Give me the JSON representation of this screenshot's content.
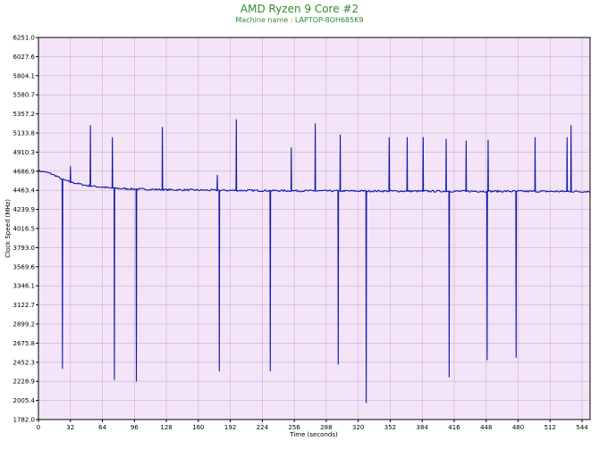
{
  "colors": {
    "title": "#2e8b2e",
    "plot_background": "#f3e4f7",
    "grid": "#c7aed2",
    "series": "#0d16a6",
    "axis": "#000000"
  },
  "chart_data": {
    "type": "line",
    "title": "AMD Ryzen 9 Core #2",
    "subtitle": "Machine name : LAPTOP-8OH685K9",
    "xlabel": "Time (seconds)",
    "ylabel": "Clock Speed (MHz)",
    "xlim": [
      0,
      552
    ],
    "ylim": [
      1782.0,
      6251.0
    ],
    "grid": true,
    "x_ticks": [
      0,
      32,
      64,
      96,
      128,
      160,
      192,
      224,
      256,
      288,
      320,
      352,
      384,
      416,
      448,
      480,
      512,
      544
    ],
    "y_ticks": [
      1782.0,
      2005.4,
      2228.9,
      2452.3,
      2675.8,
      2899.2,
      3122.7,
      3346.1,
      3569.6,
      3793.0,
      4016.5,
      4239.9,
      4463.4,
      4686.9,
      4910.3,
      5133.8,
      5357.2,
      5580.7,
      5804.1,
      6027.6,
      6251.0
    ],
    "series": [
      {
        "baseline": [
          [
            0,
            4690
          ],
          [
            6,
            4680
          ],
          [
            12,
            4660
          ],
          [
            18,
            4630
          ],
          [
            24,
            4590
          ],
          [
            32,
            4560
          ],
          [
            40,
            4540
          ],
          [
            48,
            4520
          ],
          [
            56,
            4510
          ],
          [
            64,
            4500
          ],
          [
            72,
            4490
          ],
          [
            80,
            4485
          ],
          [
            96,
            4478
          ],
          [
            112,
            4474
          ],
          [
            128,
            4470
          ],
          [
            160,
            4466
          ],
          [
            192,
            4462
          ],
          [
            224,
            4460
          ],
          [
            256,
            4458
          ],
          [
            288,
            4456
          ],
          [
            320,
            4455
          ],
          [
            352,
            4454
          ],
          [
            384,
            4453
          ],
          [
            416,
            4452
          ],
          [
            448,
            4452
          ],
          [
            480,
            4451
          ],
          [
            512,
            4450
          ],
          [
            552,
            4449
          ]
        ],
        "spikes": [
          [
            24,
            2380
          ],
          [
            32,
            4740
          ],
          [
            52,
            5220
          ],
          [
            74,
            5080
          ],
          [
            76,
            2250
          ],
          [
            98,
            2230
          ],
          [
            124,
            5200
          ],
          [
            179,
            4640
          ],
          [
            181,
            2350
          ],
          [
            198,
            5290
          ],
          [
            232,
            2350
          ],
          [
            253,
            4960
          ],
          [
            277,
            5240
          ],
          [
            300,
            2430
          ],
          [
            302,
            5110
          ],
          [
            328,
            1980
          ],
          [
            351,
            5080
          ],
          [
            369,
            5080
          ],
          [
            385,
            5080
          ],
          [
            408,
            5060
          ],
          [
            411,
            2280
          ],
          [
            428,
            5040
          ],
          [
            449,
            2480
          ],
          [
            450,
            5050
          ],
          [
            478,
            2510
          ],
          [
            497,
            5080
          ],
          [
            529,
            5080
          ],
          [
            533,
            5220
          ]
        ]
      }
    ]
  }
}
